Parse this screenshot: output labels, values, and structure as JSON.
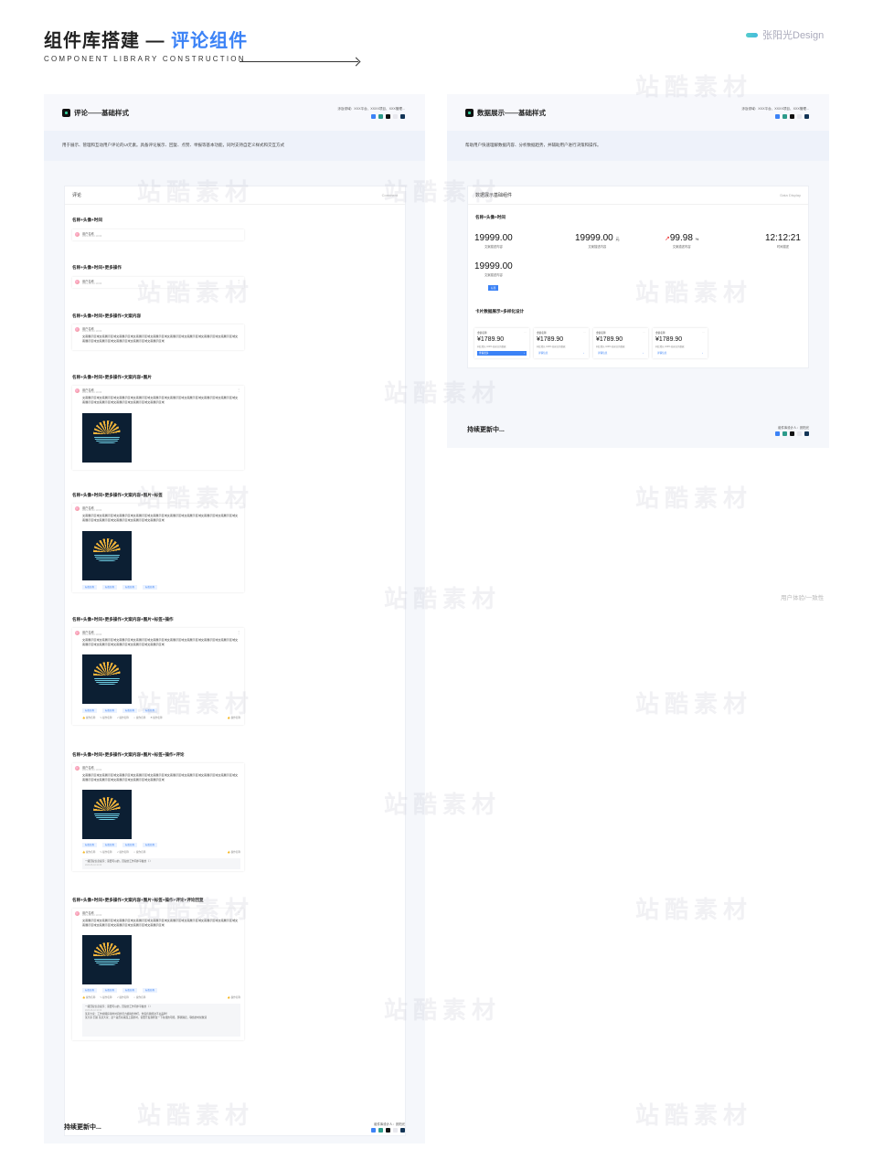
{
  "header": {
    "title_main": "组件库搭建 —",
    "title_accent": "评论组件",
    "subtitle": "COMPONENT LIBRARY CONSTRUCTION",
    "brand": "张阳光Design"
  },
  "left": {
    "title": "评论——基础样式",
    "meta": "涉及领域：XXX平台、XXXX项目、XXX管理...",
    "desc": "用于展示、管理和互动用户评论的UI元素。具备评论展示、回复、点赞、举报等基本功能，同时支持自定义样式和交互方式",
    "card_title": "评论",
    "card_en": "Comment",
    "sections": [
      "名称+头像+时间",
      "名称+头像+时间+更多操作",
      "名称+头像+时间+更多操作+文案内容",
      "名称+头像+时间+更多操作+文案内容+图片",
      "名称+头像+时间+更多操作+文案内容+图片+标签",
      "名称+头像+时间+更多操作+文案内容+图片+标签+操作",
      "名称+头像+时间+更多操作+文案内容+图片+标签+操作+评论",
      "名称+头像+时间+更多操作+文案内容+图片+标签+操作+评论+评论回复"
    ],
    "user": "用户名称",
    "time": "2023-06-10 10:00",
    "body": "文案展示区域文案展示区域文案展示区域文案展示区域文案展示区域文案展示区域文案展示区域文案展示区域文案展示区域文案展示区域文案展示区域文案展示区域文案展示区域文案展示区域",
    "tag": "标签名称",
    "action": "操作名称",
    "reply1": "一级回复信息提示：需要可以的，回复的工作同步平板的（ ）",
    "reply2": "某某大家：工作视频获得的时间的活力模拟给你们，你没有我能这不主品牌？",
    "reply3": "某大家 回复 某某大家：这个是否在版面上面的时，需要开发我修改一下在线的可能。那我确定，联络的时候做道",
    "footer": "持续更新中...",
    "footer_meta": "组件库设计人：张阳光"
  },
  "right": {
    "title": "数据展示——基础样式",
    "meta": "涉及领域：XXX平台、XXXX项目、XXX管理...",
    "desc": "帮助用户快速理解数据内容、分析数据趋势，并辅助用户进行决策和操作。",
    "card_title": "数据展示基础组件",
    "card_en": "Data Display",
    "sec1": "名称+头像+时间",
    "kpis": [
      {
        "v": "19999.00",
        "u": "",
        "l": "文案描述内容"
      },
      {
        "v": "19999.00",
        "u": "元",
        "l": "文案描述内容"
      },
      {
        "v": "99.98",
        "u": "%",
        "l": "文案描述内容",
        "arrow": "↗"
      },
      {
        "v": "12:12:21",
        "u": "",
        "l": "时间描述"
      }
    ],
    "kpi5": {
      "v": "19999.00",
      "l": "文案描述内容",
      "btn": "标签"
    },
    "sec2": "卡片数据展示+多样化设计",
    "minis": [
      {
        "h": "金额名称",
        "v": "¥1789.90",
        "d": "同比增长 100% 较前日的数据",
        "f": "查看更多",
        "hl": true
      },
      {
        "h": "金额名称",
        "v": "¥1789.90",
        "d": "同比增长 100% 较前日的数据",
        "f": "详情信息",
        "hl": false
      },
      {
        "h": "金额名称",
        "v": "¥1789.90",
        "d": "同比增长 100% 较前日的数据",
        "f": "详情信息",
        "hl": false
      },
      {
        "h": "金额名称",
        "v": "¥1789.90",
        "d": "同比增长 100% 较前日的数据",
        "f": "详情信息",
        "hl": false
      }
    ],
    "footer": "持续更新中...",
    "footer_meta": "组件库设计人：张阳光"
  },
  "side_note": "用户体验/一致性",
  "watermark": "站酷素材",
  "colors": {
    "accent": "#3b82f6",
    "badges": [
      "#3b82f6",
      "#2c9b8a",
      "#111111",
      "#e8e8ee",
      "#123456"
    ]
  }
}
